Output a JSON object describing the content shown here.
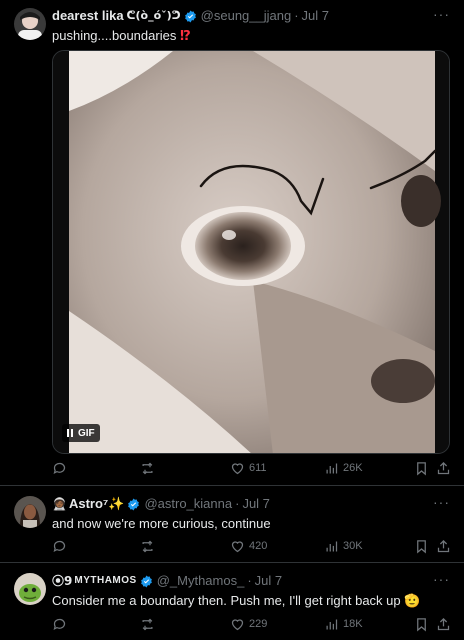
{
  "tweets": [
    {
      "name": "dearest lika",
      "name_suffix": "ᕦ(ò_óˇ)ᕤ",
      "handle": "@seung__jjang",
      "time": "Jul 7",
      "text": "pushing....boundaries",
      "text_suffix": "⁉",
      "media_badge": "GIF",
      "replies": "",
      "retweets": "",
      "likes": "611",
      "views": "26K"
    },
    {
      "name": "Astro⁷✨",
      "name_prefix": "🧑🏾‍🚀",
      "handle": "@astro_kianna",
      "time": "Jul 7",
      "text": "and now we're more curious, continue",
      "likes": "420",
      "views": "30K"
    },
    {
      "name": "MYTHAMOS",
      "name_prefix": "⦿9",
      "handle": "@_Mythamos_",
      "time": "Jul 7",
      "text": "Consider me a boundary then. Push me, I'll get right back up",
      "text_suffix": "🫡",
      "likes": "229",
      "views": "18K"
    }
  ],
  "ui": {
    "more_label": "···",
    "dot": "·"
  },
  "colors": {
    "background": "#000000",
    "verified": "#1d9bf0",
    "muted": "#71767b",
    "divider": "#2f3336"
  }
}
